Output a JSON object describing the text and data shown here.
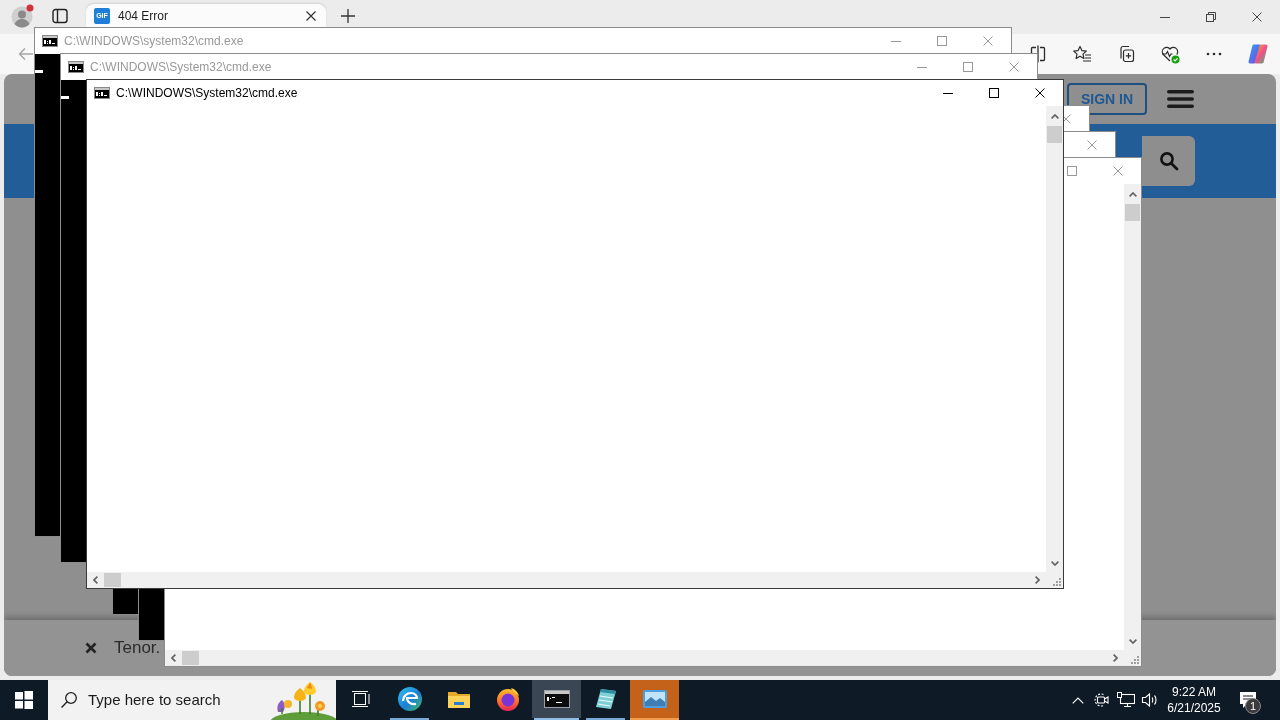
{
  "browser": {
    "tabs": [
      {
        "favicon": "GIF",
        "title": "404 Error",
        "selected": true
      }
    ],
    "page": {
      "sign_in": "SIGN IN",
      "footer_text": "Tenor."
    }
  },
  "windows": [
    {
      "kind": "prompt",
      "title": "C:\\WINDOWS\\system32\\cmd.exe",
      "active": false,
      "controls": [
        {
          "kind": "minimize"
        },
        {
          "kind": "maximize"
        },
        {
          "kind": "close"
        }
      ]
    },
    {
      "kind": "prompt",
      "title": "C:\\WINDOWS\\System32\\cmd.exe",
      "active": false,
      "controls": [
        {
          "kind": "minimize"
        },
        {
          "kind": "maximize"
        },
        {
          "kind": "close"
        }
      ]
    },
    {
      "kind": "blank",
      "title": "C:\\WINDOWS\\System32\\cmd.exe",
      "active": true,
      "controls": [
        {
          "kind": "minimize"
        },
        {
          "kind": "maximize"
        },
        {
          "kind": "close"
        }
      ]
    },
    {
      "kind": "scrolled",
      "active": false,
      "controls": [
        {
          "kind": "close"
        }
      ]
    },
    {
      "kind": "dark",
      "active": false,
      "controls": [
        {
          "kind": "close"
        }
      ]
    },
    {
      "kind": "blank",
      "active": false,
      "controls": [
        {
          "kind": "maximize"
        },
        {
          "kind": "close"
        }
      ]
    }
  ],
  "taskbar": {
    "search": {
      "placeholder": "Type here to search"
    },
    "buttons": [
      {
        "kind": "task-view",
        "running": false,
        "selected": false,
        "flashing": false
      },
      {
        "kind": "browser",
        "running": true,
        "selected": false,
        "flashing": false
      },
      {
        "kind": "folder",
        "running": false,
        "selected": false,
        "flashing": false
      },
      {
        "kind": "flame-browser",
        "running": false,
        "selected": false,
        "flashing": false
      },
      {
        "kind": "terminal",
        "running": true,
        "selected": true,
        "flashing": false
      },
      {
        "kind": "notepad",
        "running": true,
        "selected": false,
        "flashing": false
      },
      {
        "kind": "picture",
        "running": true,
        "selected": false,
        "flashing": true
      }
    ],
    "clock": {
      "time": "9:22 AM",
      "date": "6/21/2025"
    },
    "notifications": {
      "count": "1"
    }
  }
}
